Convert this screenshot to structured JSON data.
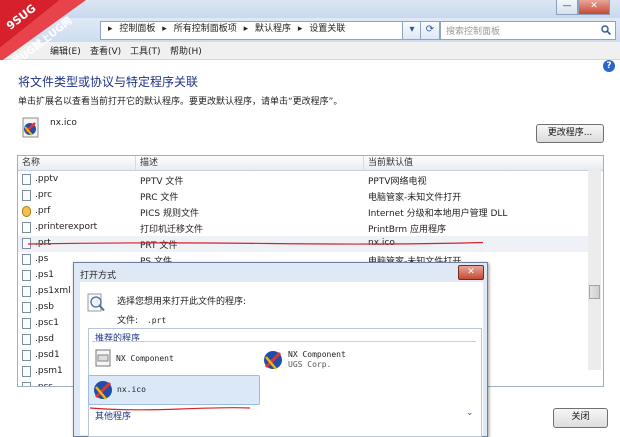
{
  "window": {
    "minimize": "—",
    "close": "✕",
    "breadcrumbs": [
      "控制面板",
      "所有控制面板项",
      "默认程序",
      "设置关联"
    ],
    "search_placeholder": "搜索控制面板"
  },
  "watermark": {
    "line1": "9SUG",
    "line2": "学UG就上UG网"
  },
  "menu": [
    "编辑(E)",
    "查看(V)",
    "工具(T)",
    "帮助(H)"
  ],
  "page": {
    "heading": "将文件类型或协议与特定程序关联",
    "subtext": "单击扩展名以查看当前打开它的默认程序。要更改默认程序，请单击“更改程序”。",
    "current_file": "nx.ico",
    "change_button": "更改程序...",
    "close_button": "关闭",
    "help": "?"
  },
  "table": {
    "columns": [
      "名称",
      "描述",
      "当前默认值"
    ],
    "rows": [
      {
        "name": ".pptv",
        "desc": "PPTV 文件",
        "default": "PPTV网络电视"
      },
      {
        "name": ".prc",
        "desc": "PRC 文件",
        "default": "电脑管家-未知文件打开"
      },
      {
        "name": ".prf",
        "desc": "PICS 规则文件",
        "default": "Internet 分级和本地用户管理 DLL"
      },
      {
        "name": ".printerexport",
        "desc": "打印机迁移文件",
        "default": "PrintBrm 应用程序"
      },
      {
        "name": ".prt",
        "desc": "PRT 文件",
        "default": "nx.ico"
      },
      {
        "name": ".ps",
        "desc": "PS 文件",
        "default": "电脑管家-未知文件打开"
      },
      {
        "name": ".ps1",
        "desc": "",
        "default": ""
      },
      {
        "name": ".ps1xml",
        "desc": "",
        "default": ""
      },
      {
        "name": ".psb",
        "desc": "",
        "default": ""
      },
      {
        "name": ".psc1",
        "desc": "",
        "default": ""
      },
      {
        "name": ".psd",
        "desc": "",
        "default": ""
      },
      {
        "name": ".psd1",
        "desc": "",
        "default": ""
      },
      {
        "name": ".psm1",
        "desc": "",
        "default": ""
      },
      {
        "name": ".pss",
        "desc": "",
        "default": ""
      }
    ]
  },
  "dialog": {
    "title": "打开方式",
    "close": "✕",
    "question": "选择您想用来打开此文件的程序:",
    "file_label": "文件:",
    "file_value": ".prt",
    "recommended_label": "推荐的程序",
    "programs": [
      {
        "name": "NX Component",
        "publisher": ""
      },
      {
        "name": "NX Component",
        "publisher": "UGS Corp."
      },
      {
        "name": "nx.ico",
        "publisher": ""
      }
    ],
    "other_label": "其他程序"
  },
  "colors": {
    "heading": "#1e3287",
    "annotation": "#d6202b",
    "selection": "#dbe8f8"
  }
}
